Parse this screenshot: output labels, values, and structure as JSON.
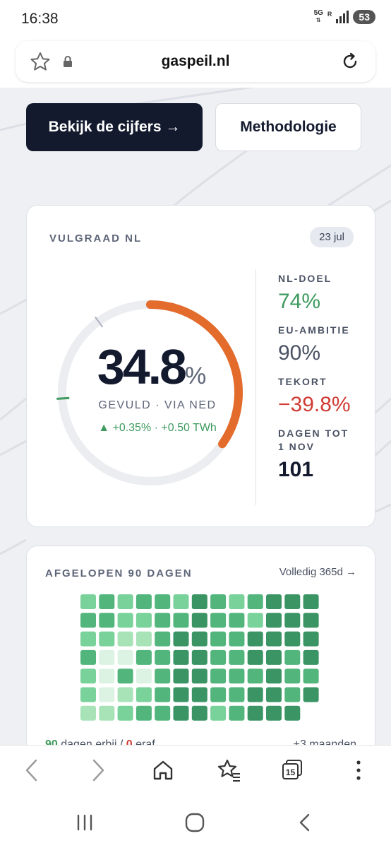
{
  "status_bar": {
    "time": "16:38",
    "network": "5G",
    "roaming": "R",
    "battery": "53"
  },
  "browser": {
    "url": "gaspeil.nl",
    "icons": [
      "star-icon",
      "lock-icon",
      "reload-icon",
      "back-icon",
      "forward-icon",
      "home-icon",
      "bookmarks-icon",
      "tabs-icon",
      "menu-icon"
    ],
    "tab_count": "15"
  },
  "hero": {
    "primary_button": "Bekijk de cijfers →",
    "secondary_button": "Methodologie"
  },
  "fill_card": {
    "title": "VULGRAAD NL",
    "date": "23 jul",
    "value": "34.8",
    "unit": "%",
    "fill_fraction": 0.348,
    "subtitle": "GEVULD · VIA NED",
    "delta": "▲ +0.35% · +0.50 TWh",
    "stats": [
      {
        "label": "NL-DOEL",
        "value": "74%",
        "tone": "green"
      },
      {
        "label": "EU-AMBITIE",
        "value": "90%",
        "tone": "gray"
      },
      {
        "label": "TEKORT",
        "value": "−39.8%",
        "tone": "red"
      },
      {
        "label": "DAGEN TOT 1 NOV",
        "value": "101",
        "tone": "dark"
      }
    ],
    "colors": {
      "arc": "#e36b2c",
      "track": "#ebedf1",
      "nl_marker": "#3e9a5e",
      "eu_marker": "#a9b1bf"
    }
  },
  "history_card": {
    "title": "AFGELOPEN 90 DAGEN",
    "link": "Volledig 365d →",
    "footer_left_count_up": "90",
    "footer_left_text_up": "dagen erbij",
    "footer_sep": "/",
    "footer_left_count_down": "0",
    "footer_left_text_down": "eraf",
    "footer_right": "+3 maanden",
    "heatmap": {
      "columns": 13,
      "rows": 7,
      "levels": [
        [
          2,
          3,
          2,
          3,
          3,
          2,
          4,
          3,
          2,
          3,
          4,
          4,
          4
        ],
        [
          3,
          3,
          2,
          2,
          3,
          3,
          4,
          3,
          3,
          2,
          4,
          4,
          4
        ],
        [
          2,
          2,
          1,
          1,
          3,
          4,
          4,
          3,
          3,
          4,
          4,
          4,
          4
        ],
        [
          3,
          0,
          0,
          3,
          3,
          4,
          4,
          3,
          3,
          4,
          4,
          3,
          4
        ],
        [
          2,
          0,
          3,
          0,
          3,
          4,
          4,
          3,
          3,
          3,
          4,
          3,
          3
        ],
        [
          2,
          0,
          1,
          2,
          3,
          4,
          4,
          3,
          3,
          4,
          4,
          3,
          4
        ],
        [
          1,
          1,
          2,
          3,
          3,
          4,
          4,
          2,
          3,
          4,
          4,
          4,
          -1
        ]
      ],
      "palette": [
        "#dcf3e3",
        "#a8e3b8",
        "#79d29a",
        "#52b57c",
        "#3a9464"
      ]
    }
  }
}
